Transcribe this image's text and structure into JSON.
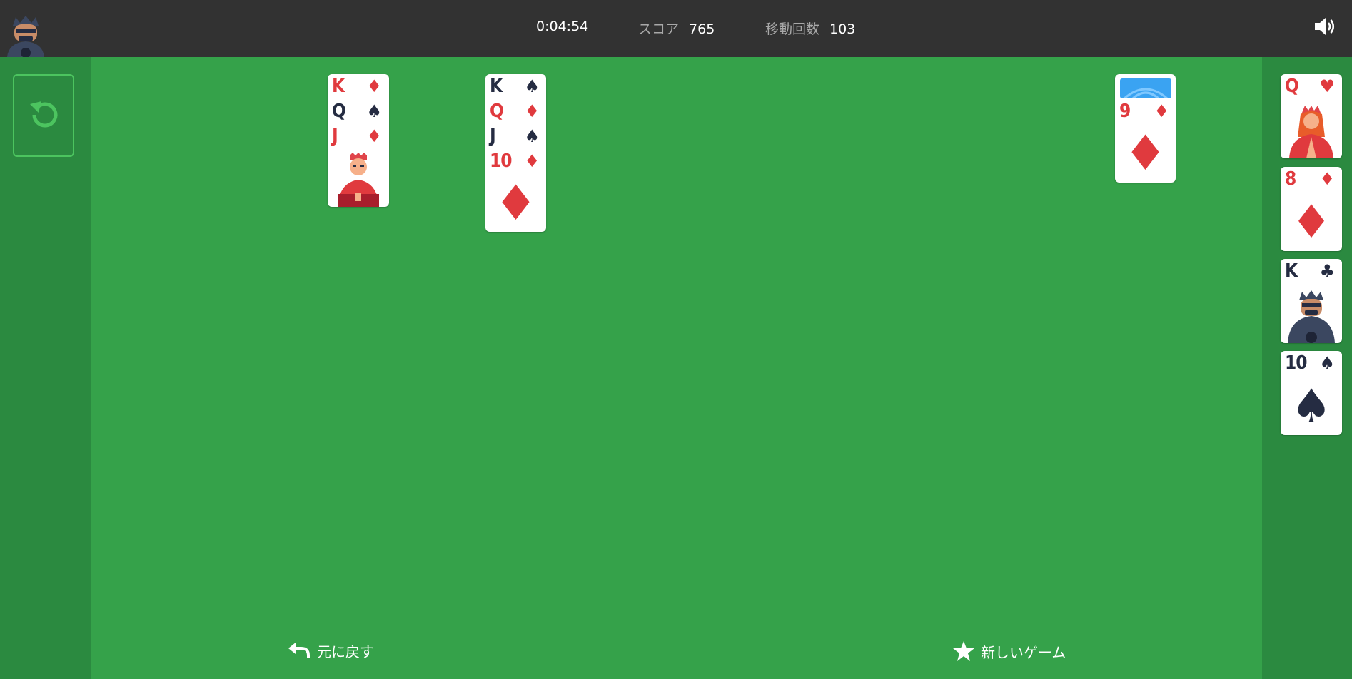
{
  "header": {
    "timer": "0:04:54",
    "score_label": "スコア",
    "score_value": "765",
    "moves_label": "移動回数",
    "moves_value": "103",
    "avatar_icon": "king-avatar-icon",
    "sound_icon": "speaker-icon"
  },
  "stock": {
    "icon": "refresh-icon"
  },
  "tableau": [
    {
      "cards": [
        {
          "rank": "K",
          "suit": "♦"
        },
        {
          "rank": "Q",
          "suit": "♠"
        },
        {
          "rank": "J",
          "suit": "♦"
        }
      ]
    },
    {
      "cards": [
        {
          "rank": "K",
          "suit": "♠"
        },
        {
          "rank": "Q",
          "suit": "♦"
        },
        {
          "rank": "J",
          "suit": "♠"
        },
        {
          "rank": "10",
          "suit": "♦"
        }
      ]
    },
    {
      "cards": [
        {
          "rank": "9",
          "suit": "♦"
        }
      ]
    }
  ],
  "foundations": [
    {
      "rank": "Q",
      "suit": "♥"
    },
    {
      "rank": "8",
      "suit": "♦"
    },
    {
      "rank": "K",
      "suit": "♣"
    },
    {
      "rank": "10",
      "suit": "♠"
    }
  ],
  "buttons": {
    "undo_label": "元に戻す",
    "new_game_label": "新しいゲーム"
  },
  "colors": {
    "felt": "#35a24a",
    "sidebar": "#2b8a40",
    "topbar": "#323232",
    "red_suit": "#e03a3e",
    "black_suit": "#252c42"
  }
}
